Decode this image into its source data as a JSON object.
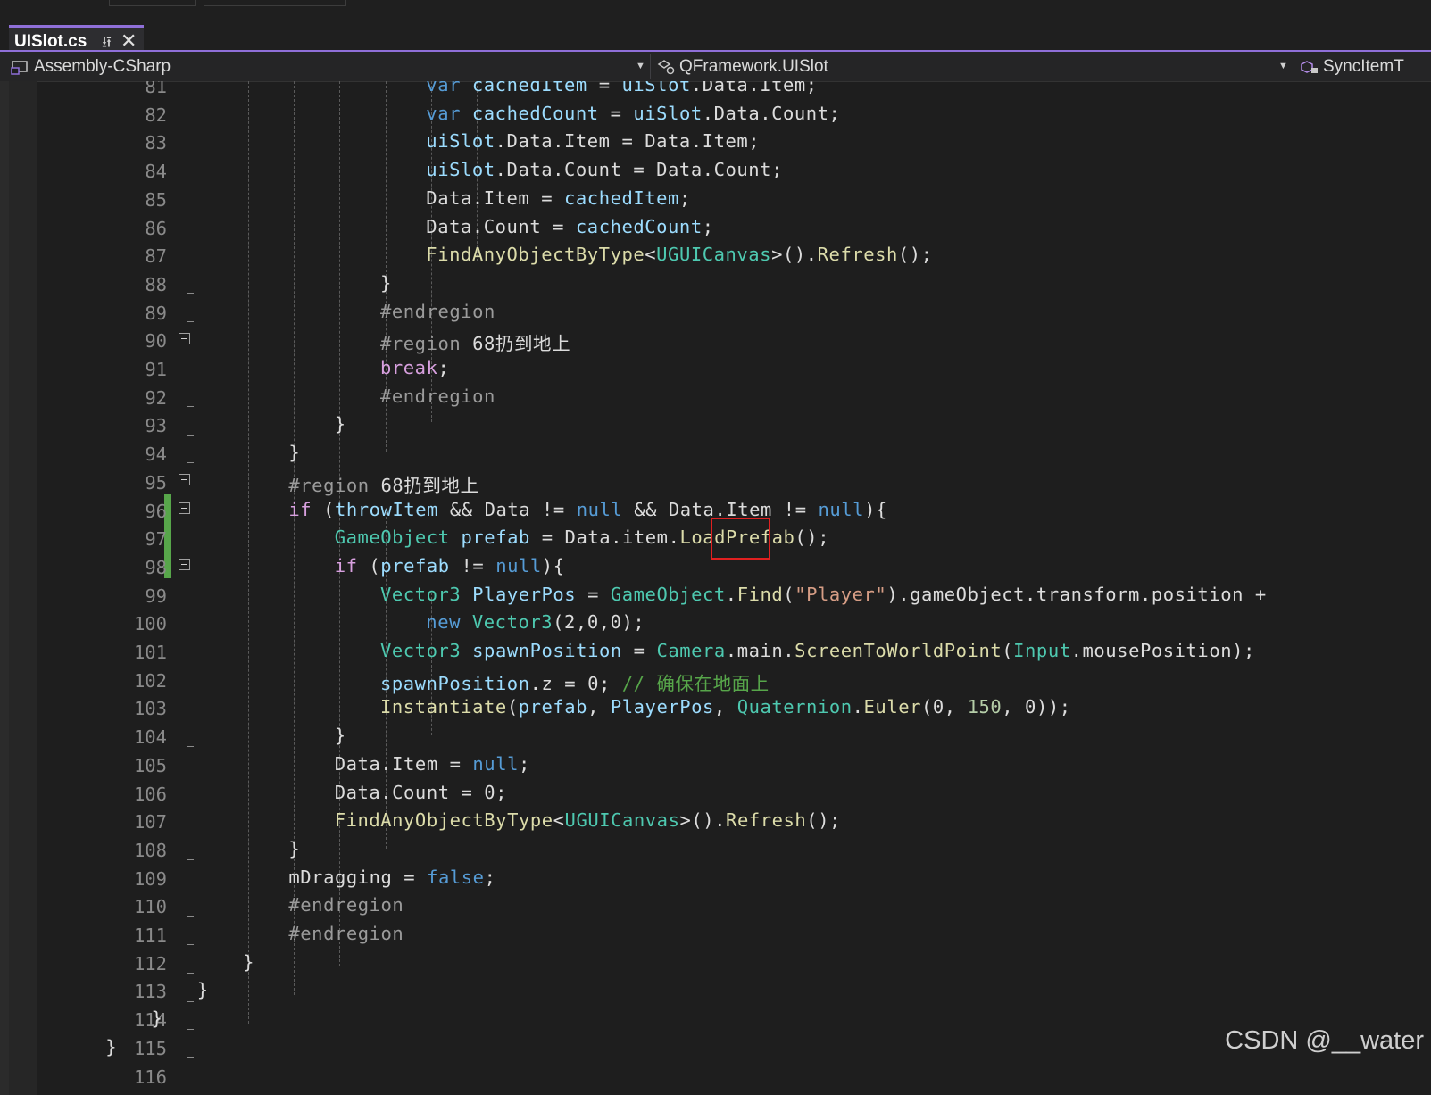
{
  "tab": {
    "title": "UISlot.cs",
    "pin": "⭿",
    "close": "✕"
  },
  "navbar": {
    "project": "Assembly-CSharp",
    "type": "QFramework.UISlot",
    "member": "SyncItemT"
  },
  "watermark": "CSDN @__water",
  "lines": [
    {
      "n": "81",
      "indent": 11,
      "tokens": [
        [
          "kw",
          "var"
        ],
        [
          "plain",
          " "
        ],
        [
          "var",
          "cachedItem"
        ],
        [
          "plain",
          " = "
        ],
        [
          "var",
          "uiSlot"
        ],
        [
          "plain",
          ".Data.Item;"
        ]
      ]
    },
    {
      "n": "82",
      "indent": 11,
      "tokens": [
        [
          "kw",
          "var"
        ],
        [
          "plain",
          " "
        ],
        [
          "var",
          "cachedCount"
        ],
        [
          "plain",
          " = "
        ],
        [
          "var",
          "uiSlot"
        ],
        [
          "plain",
          ".Data.Count;"
        ]
      ]
    },
    {
      "n": "83",
      "indent": 11,
      "tokens": [
        [
          "var",
          "uiSlot"
        ],
        [
          "plain",
          ".Data.Item = Data.Item;"
        ]
      ]
    },
    {
      "n": "84",
      "indent": 11,
      "tokens": [
        [
          "var",
          "uiSlot"
        ],
        [
          "plain",
          ".Data.Count = Data.Count;"
        ]
      ]
    },
    {
      "n": "85",
      "indent": 11,
      "tokens": [
        [
          "plain",
          "Data.Item = "
        ],
        [
          "var",
          "cachedItem"
        ],
        [
          "plain",
          ";"
        ]
      ]
    },
    {
      "n": "86",
      "indent": 11,
      "tokens": [
        [
          "plain",
          "Data.Count = "
        ],
        [
          "var",
          "cachedCount"
        ],
        [
          "plain",
          ";"
        ]
      ]
    },
    {
      "n": "87",
      "indent": 11,
      "tokens": [
        [
          "method",
          "FindAnyObjectByType"
        ],
        [
          "plain",
          "<"
        ],
        [
          "type",
          "UGUICanvas"
        ],
        [
          "plain",
          ">()."
        ],
        [
          "method",
          "Refresh"
        ],
        [
          "plain",
          "();"
        ]
      ]
    },
    {
      "n": "88",
      "indent": 10,
      "tokens": [
        [
          "plain",
          "}"
        ]
      ]
    },
    {
      "n": "89",
      "indent": 10,
      "tokens": [
        [
          "pre",
          "#endregion"
        ]
      ]
    },
    {
      "n": "90",
      "indent": 10,
      "tokens": [
        [
          "pre",
          "#region "
        ],
        [
          "plain",
          "68扔到地上"
        ]
      ]
    },
    {
      "n": "91",
      "indent": 10,
      "tokens": [
        [
          "ctl",
          "break"
        ],
        [
          "plain",
          ";"
        ]
      ]
    },
    {
      "n": "92",
      "indent": 10,
      "tokens": [
        [
          "pre",
          "#endregion"
        ]
      ]
    },
    {
      "n": "93",
      "indent": 9,
      "tokens": [
        [
          "plain",
          "}"
        ]
      ]
    },
    {
      "n": "94",
      "indent": 8,
      "tokens": [
        [
          "plain",
          "}"
        ]
      ]
    },
    {
      "n": "95",
      "indent": 8,
      "tokens": [
        [
          "pre",
          "#region "
        ],
        [
          "plain",
          "68扔到地上"
        ]
      ]
    },
    {
      "n": "96",
      "indent": 8,
      "tokens": [
        [
          "ctl",
          "if"
        ],
        [
          "plain",
          " ("
        ],
        [
          "var",
          "throwItem"
        ],
        [
          "plain",
          " && Data != "
        ],
        [
          "kw",
          "null"
        ],
        [
          "plain",
          " && Data.Item != "
        ],
        [
          "kw",
          "null"
        ],
        [
          "plain",
          "){"
        ]
      ]
    },
    {
      "n": "97",
      "indent": 9,
      "tokens": [
        [
          "type",
          "GameObject"
        ],
        [
          "plain",
          " "
        ],
        [
          "var",
          "prefab"
        ],
        [
          "plain",
          " = Data.item."
        ],
        [
          "method",
          "LoadPrefab"
        ],
        [
          "plain",
          "();"
        ]
      ]
    },
    {
      "n": "98",
      "indent": 9,
      "tokens": [
        [
          "ctl",
          "if"
        ],
        [
          "plain",
          " ("
        ],
        [
          "var",
          "prefab"
        ],
        [
          "plain",
          " != "
        ],
        [
          "kw",
          "null"
        ],
        [
          "plain",
          "){"
        ]
      ]
    },
    {
      "n": "99",
      "indent": 10,
      "tokens": [
        [
          "type",
          "Vector3"
        ],
        [
          "plain",
          " "
        ],
        [
          "var",
          "PlayerPos"
        ],
        [
          "plain",
          " = "
        ],
        [
          "type",
          "GameObject"
        ],
        [
          "plain",
          "."
        ],
        [
          "method",
          "Find"
        ],
        [
          "plain",
          "("
        ],
        [
          "str",
          "\"Player\""
        ],
        [
          "plain",
          ").gameObject.transform.position +"
        ]
      ]
    },
    {
      "n": "100",
      "indent": 11,
      "tokens": [
        [
          "kw",
          "new"
        ],
        [
          "plain",
          " "
        ],
        [
          "type",
          "Vector3"
        ],
        [
          "plain",
          "(2,0,0);"
        ]
      ]
    },
    {
      "n": "101",
      "indent": 10,
      "tokens": [
        [
          "type",
          "Vector3"
        ],
        [
          "plain",
          " "
        ],
        [
          "var",
          "spawnPosition"
        ],
        [
          "plain",
          " = "
        ],
        [
          "type",
          "Camera"
        ],
        [
          "plain",
          ".main."
        ],
        [
          "method",
          "ScreenToWorldPoint"
        ],
        [
          "plain",
          "("
        ],
        [
          "type",
          "Input"
        ],
        [
          "plain",
          ".mousePosition);"
        ]
      ]
    },
    {
      "n": "102",
      "indent": 10,
      "tokens": [
        [
          "var",
          "spawnPosition"
        ],
        [
          "plain",
          ".z = 0; "
        ],
        [
          "cmt",
          "// 确保在地面上"
        ]
      ]
    },
    {
      "n": "103",
      "indent": 10,
      "tokens": [
        [
          "method",
          "Instantiate"
        ],
        [
          "plain",
          "("
        ],
        [
          "var",
          "prefab"
        ],
        [
          "plain",
          ", "
        ],
        [
          "var",
          "PlayerPos"
        ],
        [
          "plain",
          ", "
        ],
        [
          "type",
          "Quaternion"
        ],
        [
          "plain",
          "."
        ],
        [
          "method",
          "Euler"
        ],
        [
          "plain",
          "(0, "
        ],
        [
          "num",
          "150"
        ],
        [
          "plain",
          ", 0));"
        ]
      ]
    },
    {
      "n": "104",
      "indent": 9,
      "tokens": [
        [
          "plain",
          "}"
        ]
      ]
    },
    {
      "n": "105",
      "indent": 9,
      "tokens": [
        [
          "plain",
          "Data.Item = "
        ],
        [
          "kw",
          "null"
        ],
        [
          "plain",
          ";"
        ]
      ]
    },
    {
      "n": "106",
      "indent": 9,
      "tokens": [
        [
          "plain",
          "Data.Count = 0;"
        ]
      ]
    },
    {
      "n": "107",
      "indent": 9,
      "tokens": [
        [
          "method",
          "FindAnyObjectByType"
        ],
        [
          "plain",
          "<"
        ],
        [
          "type",
          "UGUICanvas"
        ],
        [
          "plain",
          ">()."
        ],
        [
          "method",
          "Refresh"
        ],
        [
          "plain",
          "();"
        ]
      ]
    },
    {
      "n": "108",
      "indent": 8,
      "tokens": [
        [
          "plain",
          "}"
        ]
      ]
    },
    {
      "n": "109",
      "indent": 8,
      "tokens": [
        [
          "plain",
          "mDragging = "
        ],
        [
          "kw",
          "false"
        ],
        [
          "plain",
          ";"
        ]
      ]
    },
    {
      "n": "110",
      "indent": 8,
      "tokens": [
        [
          "pre",
          "#endregion"
        ]
      ]
    },
    {
      "n": "111",
      "indent": 8,
      "tokens": [
        [
          "pre",
          "#endregion"
        ]
      ]
    },
    {
      "n": "112",
      "indent": 7,
      "tokens": [
        [
          "plain",
          "}"
        ]
      ]
    },
    {
      "n": "113",
      "indent": 6,
      "tokens": [
        [
          "plain",
          "}"
        ]
      ]
    },
    {
      "n": "114",
      "indent": 5,
      "tokens": [
        [
          "plain",
          "}"
        ]
      ]
    },
    {
      "n": "115",
      "indent": 4,
      "tokens": [
        [
          "plain",
          "}"
        ]
      ]
    },
    {
      "n": "116",
      "indent": 0,
      "tokens": []
    }
  ]
}
